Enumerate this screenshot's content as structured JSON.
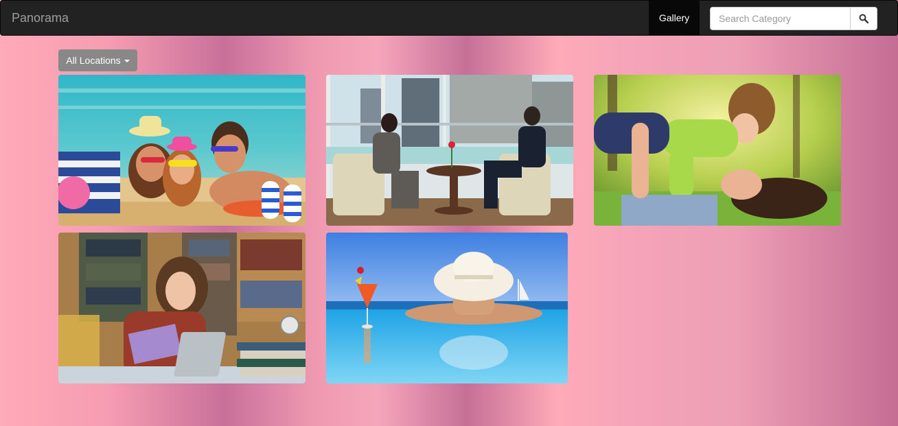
{
  "navbar": {
    "brand": "Panorama",
    "gallery_label": "Gallery",
    "search": {
      "placeholder": "Search Category"
    },
    "search_button_icon": "search-icon"
  },
  "filter": {
    "dropdown_label": "All Locations",
    "dropdown_icon": "caret-down-icon"
  },
  "gallery": {
    "photos": [
      {
        "subject": "family-beach"
      },
      {
        "subject": "business-meeting"
      },
      {
        "subject": "mother-child-park"
      },
      {
        "subject": "student-library"
      },
      {
        "subject": "woman-pool"
      }
    ]
  }
}
